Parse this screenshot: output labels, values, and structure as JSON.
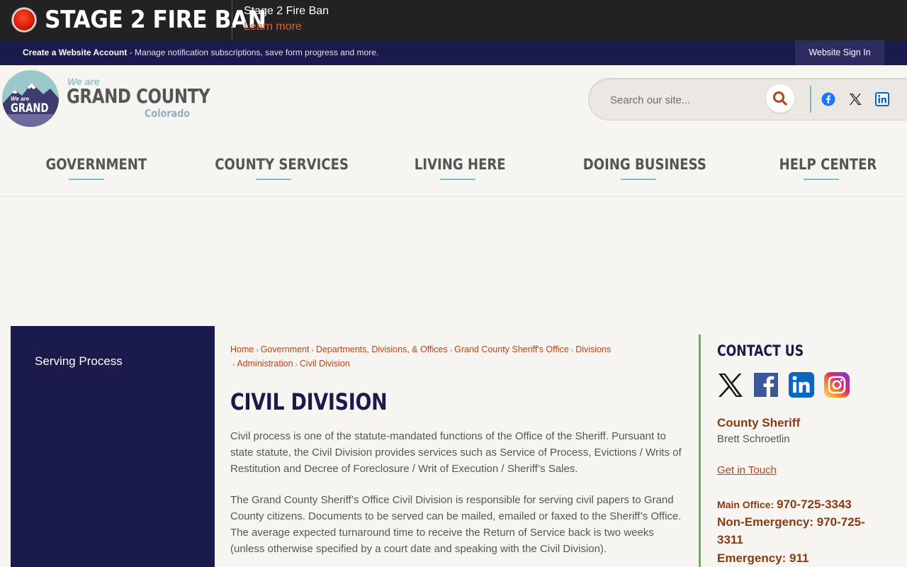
{
  "alert": {
    "title": "STAGE 2 FIRE BAN",
    "subtitle": "Stage 2 Fire Ban",
    "link": "Learn more"
  },
  "account_bar": {
    "create_label": "Create a Website Account",
    "description": " - Manage notification subscriptions, save form progress and more.",
    "signin_label": "Website Sign In"
  },
  "logo": {
    "we_are": "We are",
    "grand_county": "GRAND COUNTY",
    "colorado": "Colorado",
    "badge_text_small": "We are",
    "badge_text": "GRAND"
  },
  "search": {
    "placeholder": "Search our site..."
  },
  "social_top": [
    "facebook-icon",
    "x-icon",
    "linkedin-icon"
  ],
  "nav": {
    "items": [
      {
        "label": "GOVERNMENT"
      },
      {
        "label": "COUNTY SERVICES"
      },
      {
        "label": "LIVING HERE"
      },
      {
        "label": "DOING BUSINESS"
      },
      {
        "label": "HELP CENTER"
      }
    ]
  },
  "sidebar": {
    "items": [
      {
        "label": "Serving Process"
      }
    ]
  },
  "breadcrumb": [
    "Home",
    "Government",
    "Departments, Divisions, & Offices",
    "Grand County Sheriff's Office",
    "Divisions",
    "Administration",
    "Civil Division"
  ],
  "page": {
    "title": "CIVIL DIVISION",
    "paragraphs": [
      "Civil process is one of the statute-mandated functions of the Office of the Sheriff. Pursuant to state statute, the Civil Division provides services such as Service of Process, Evictions / Writs of Restitution and Decree of Foreclosure / Writ of Execution / Sheriff’s Sales.",
      "The Grand County Sheriff’s Office Civil Division is responsible for serving civil papers to Grand County citizens. Documents to be served can be mailed, emailed or faxed to the Sheriff’s Office. The average expected turnaround time to receive the Return of Service back is two weeks (unless otherwise specified by a court date and speaking with the Civil Division)."
    ]
  },
  "contact": {
    "title": "CONTACT US",
    "social": [
      "x-icon",
      "facebook-icon",
      "linkedin-icon",
      "instagram-icon"
    ],
    "role": "County Sheriff",
    "name": "Brett Schroetlin",
    "get_in_touch": "Get in Touch",
    "main_office_label": "Main Office: ",
    "main_office_phone": "970-725-3343",
    "non_emergency_label": "Non-Emergency: ",
    "non_emergency_phone": "970-725-3311",
    "emergency_label": "Emergency: ",
    "emergency_phone": "911"
  },
  "colors": {
    "navy": "#1a1a4c",
    "accent_orange": "#b5441a",
    "teal": "#79c1bf",
    "alert_red": "#d21a08"
  }
}
